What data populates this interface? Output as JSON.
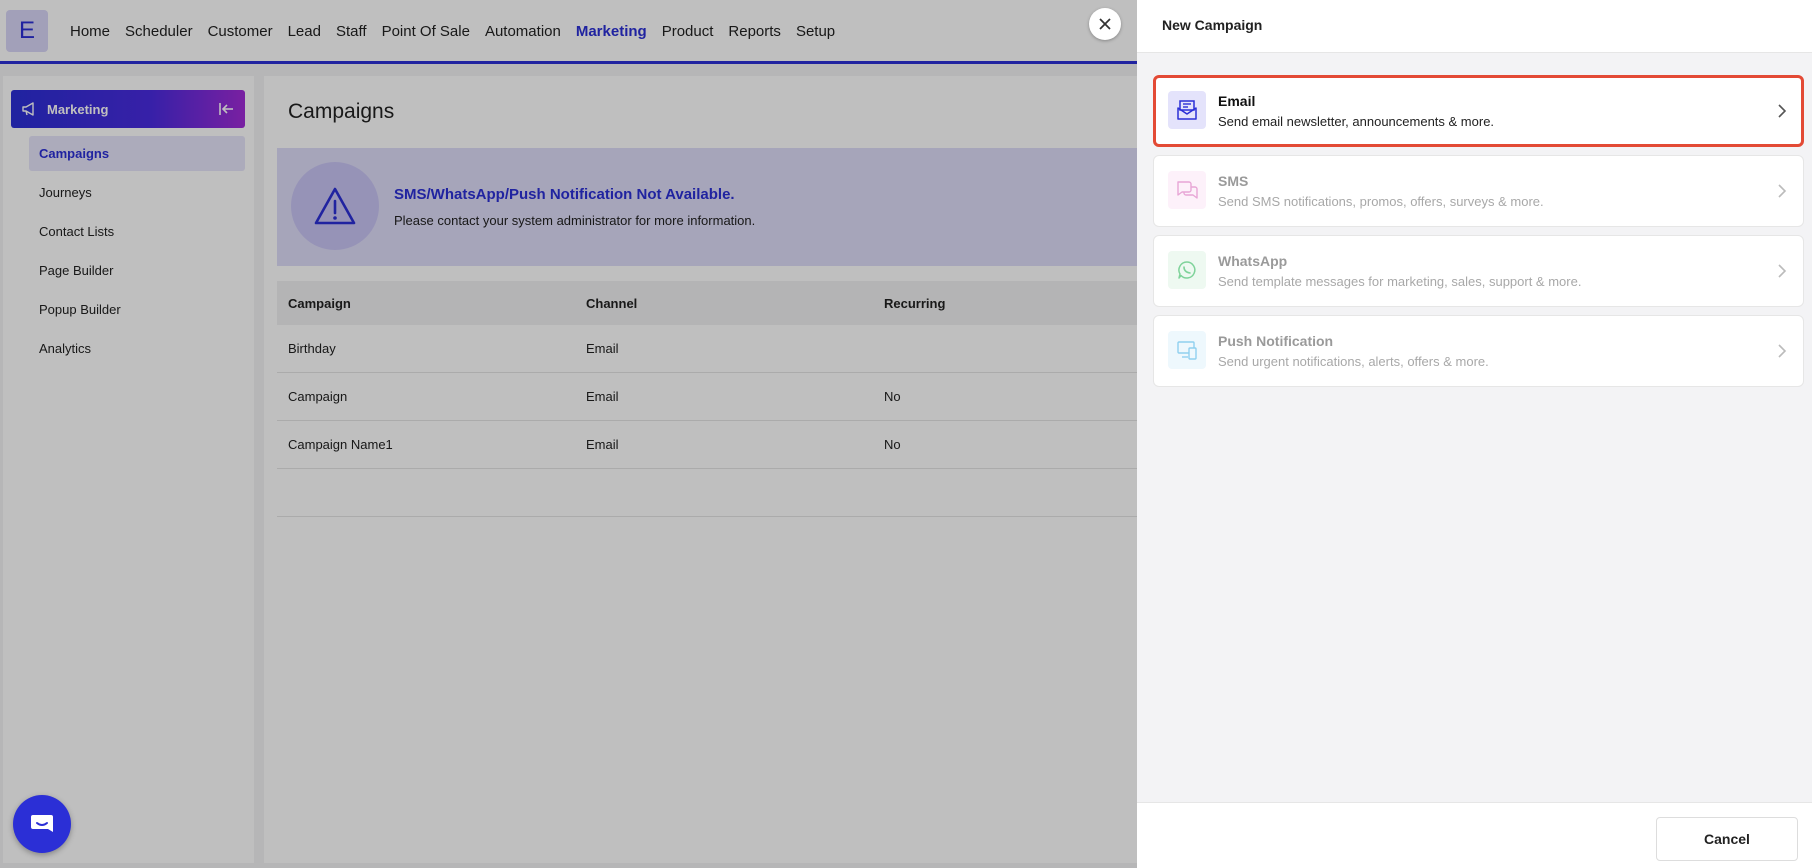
{
  "topnav": {
    "logo_letter": "E",
    "items": [
      {
        "label": "Home"
      },
      {
        "label": "Scheduler"
      },
      {
        "label": "Customer"
      },
      {
        "label": "Lead"
      },
      {
        "label": "Staff"
      },
      {
        "label": "Point Of Sale"
      },
      {
        "label": "Automation"
      },
      {
        "label": "Marketing",
        "active": true
      },
      {
        "label": "Product"
      },
      {
        "label": "Reports"
      },
      {
        "label": "Setup"
      }
    ]
  },
  "sidebar": {
    "header": "Marketing",
    "items": [
      {
        "label": "Campaigns",
        "active": true
      },
      {
        "label": "Journeys"
      },
      {
        "label": "Contact Lists"
      },
      {
        "label": "Page Builder"
      },
      {
        "label": "Popup Builder"
      },
      {
        "label": "Analytics"
      }
    ]
  },
  "main": {
    "title": "Campaigns",
    "alert": {
      "title": "SMS/WhatsApp/Push Notification Not Available.",
      "text": "Please contact your system administrator for more information."
    },
    "table": {
      "headers": [
        "Campaign",
        "Channel",
        "Recurring"
      ],
      "rows": [
        [
          "Birthday",
          "Email",
          ""
        ],
        [
          "Campaign",
          "Email",
          "No"
        ],
        [
          "Campaign Name1",
          "Email",
          "No"
        ]
      ]
    }
  },
  "drawer": {
    "title": "New Campaign",
    "options": [
      {
        "title": "Email",
        "desc": "Send email newsletter, announcements & more.",
        "icon": "email-icon",
        "accent": "#2b2fd6"
      },
      {
        "title": "SMS",
        "desc": "Send SMS notifications, promos, offers, surveys & more.",
        "icon": "chat-bubbles-icon",
        "accent": "#e8a6d6"
      },
      {
        "title": "WhatsApp",
        "desc": "Send template messages for marketing, sales, support & more.",
        "icon": "whatsapp-icon",
        "accent": "#7fd39a"
      },
      {
        "title": "Push Notification",
        "desc": "Send urgent notifications, alerts, offers & more.",
        "icon": "devices-icon",
        "accent": "#8fd0ef"
      }
    ],
    "cancel_label": "Cancel"
  },
  "colors": {
    "brand": "#2b2fd6",
    "selection_border": "#e34a35"
  }
}
